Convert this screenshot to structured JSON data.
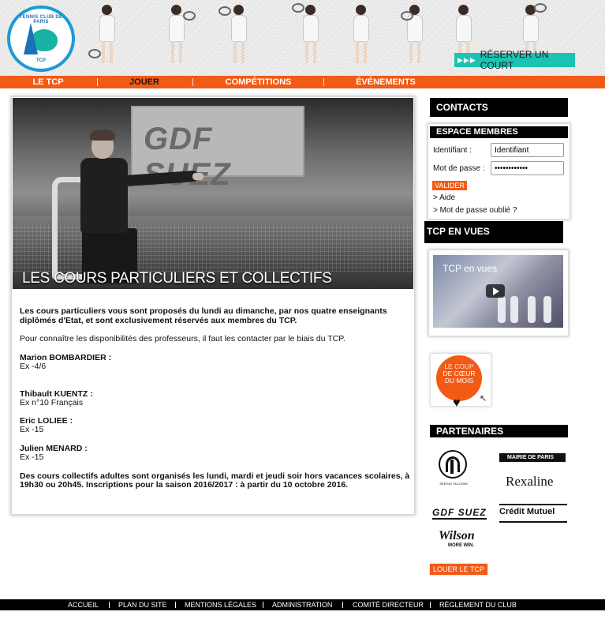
{
  "logo": {
    "ring_text": "TENNIS CLUB DE PARIS",
    "abbr": "TCP"
  },
  "header": {
    "reserve_label": "RÉSERVER UN COURT",
    "reserve_icon": "triple-arrow-icon"
  },
  "nav": {
    "items": [
      "LE TCP",
      "JOUER",
      "COMPÉTITIONS",
      "ÉVÉNEMENTS"
    ]
  },
  "main": {
    "photo_title": "LES COURS PARTICULIERS ET COLLECTIFS",
    "sign_text": "GDF SUEZ",
    "intro_bold": "Les cours particuliers vous sont proposés du lundi au dimanche,  par nos quatre enseignants diplômés d'Etat, et sont exclusivement réservés aux membres du TCP.",
    "intro_contact": "Pour connaître les disponibilités des professeurs, il faut les contacter par le biais du TCP.",
    "professors": [
      {
        "name": "Marion BOMBARDIER :",
        "rank": "Ex -4/6"
      },
      {
        "name": "Thibault KUENTZ :",
        "rank": "Ex n°10 Français"
      },
      {
        "name": "Eric LOLIEE :",
        "rank": "Ex -15"
      },
      {
        "name": "Julien MENARD :",
        "rank": "Ex -15"
      }
    ],
    "collective_bold": "Des cours collectifs adultes sont organisés les lundi, mardi et jeudi  soir hors vacances scolaires, à 19h30 ou 20h45. Inscriptions pour la saison 2016/2017 : à partir du 10 octobre 2016."
  },
  "sidebar": {
    "contacts_label": "CONTACTS",
    "members": {
      "title": "ESPACE MEMBRES",
      "id_label": "Identifiant :",
      "id_value": "Identifiant",
      "pw_label": "Mot de passe :",
      "pw_value": "••••••••••••",
      "submit": "VALIDER",
      "help": "> Aide",
      "forgot": "> Mot de passe oublié ?"
    },
    "tcp_vues_title": "TCP EN VUES",
    "video_title": "TCP en vues",
    "coup": {
      "line1": "LE COUP",
      "line2": "DE CŒUR",
      "line3": "DU MOIS"
    },
    "partners_title": "PARTENAIRES",
    "partners": [
      "SERGIO TACCHINI",
      "MAIRIE DE PARIS",
      "Rexaline",
      "GDF SUEZ",
      "Crédit Mutuel",
      "Wilson"
    ],
    "partner_sublabels": {
      "tacchini": "SERGIO TACCHINI",
      "wilson": "MORE WIN."
    },
    "louer_label": "LOUER LE TCP"
  },
  "footer": {
    "links": [
      "ACCUEIL",
      "PLAN DU SITE",
      "MENTIONS LÉGALES",
      "ADMINISTRATION",
      "COMITÉ DIRECTEUR",
      "RÈGLEMENT DU CLUB"
    ]
  },
  "colors": {
    "accent": "#f25a16",
    "teal": "#1bc3b3",
    "logo_blue": "#1d71b8",
    "black": "#000000"
  }
}
